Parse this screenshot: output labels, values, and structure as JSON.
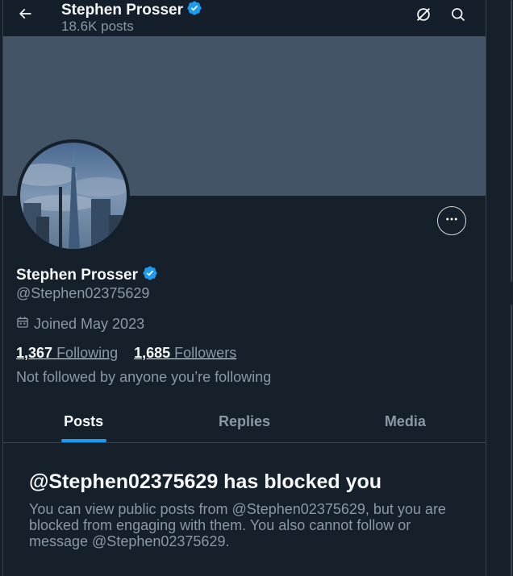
{
  "header": {
    "name": "Stephen Prosser",
    "posts_count": "18.6K posts",
    "icons": [
      "back-arrow-icon",
      "verified-badge-icon",
      "grok-icon",
      "search-icon"
    ]
  },
  "profile": {
    "name": "Stephen Prosser",
    "handle": "@Stephen02375629",
    "joined": "Joined May 2023",
    "following_count": "1,367",
    "following_label": "Following",
    "followers_count": "1,685",
    "followers_label": "Followers",
    "followed_by_text": "Not followed by anyone you’re following"
  },
  "tabs": [
    {
      "label": "Posts",
      "active": true
    },
    {
      "label": "Replies",
      "active": false
    },
    {
      "label": "Media",
      "active": false
    }
  ],
  "blocked": {
    "title": "@Stephen02375629 has blocked you",
    "body": "You can view public posts from @Stephen02375629, but you are blocked from engaging with them. You also cannot follow or message @Stephen02375629."
  },
  "colors": {
    "background": "#15202b",
    "banner": "#435466",
    "accent": "#1d9bf0",
    "secondary_text": "#8b98a5",
    "verified": "#1d9bf0"
  }
}
